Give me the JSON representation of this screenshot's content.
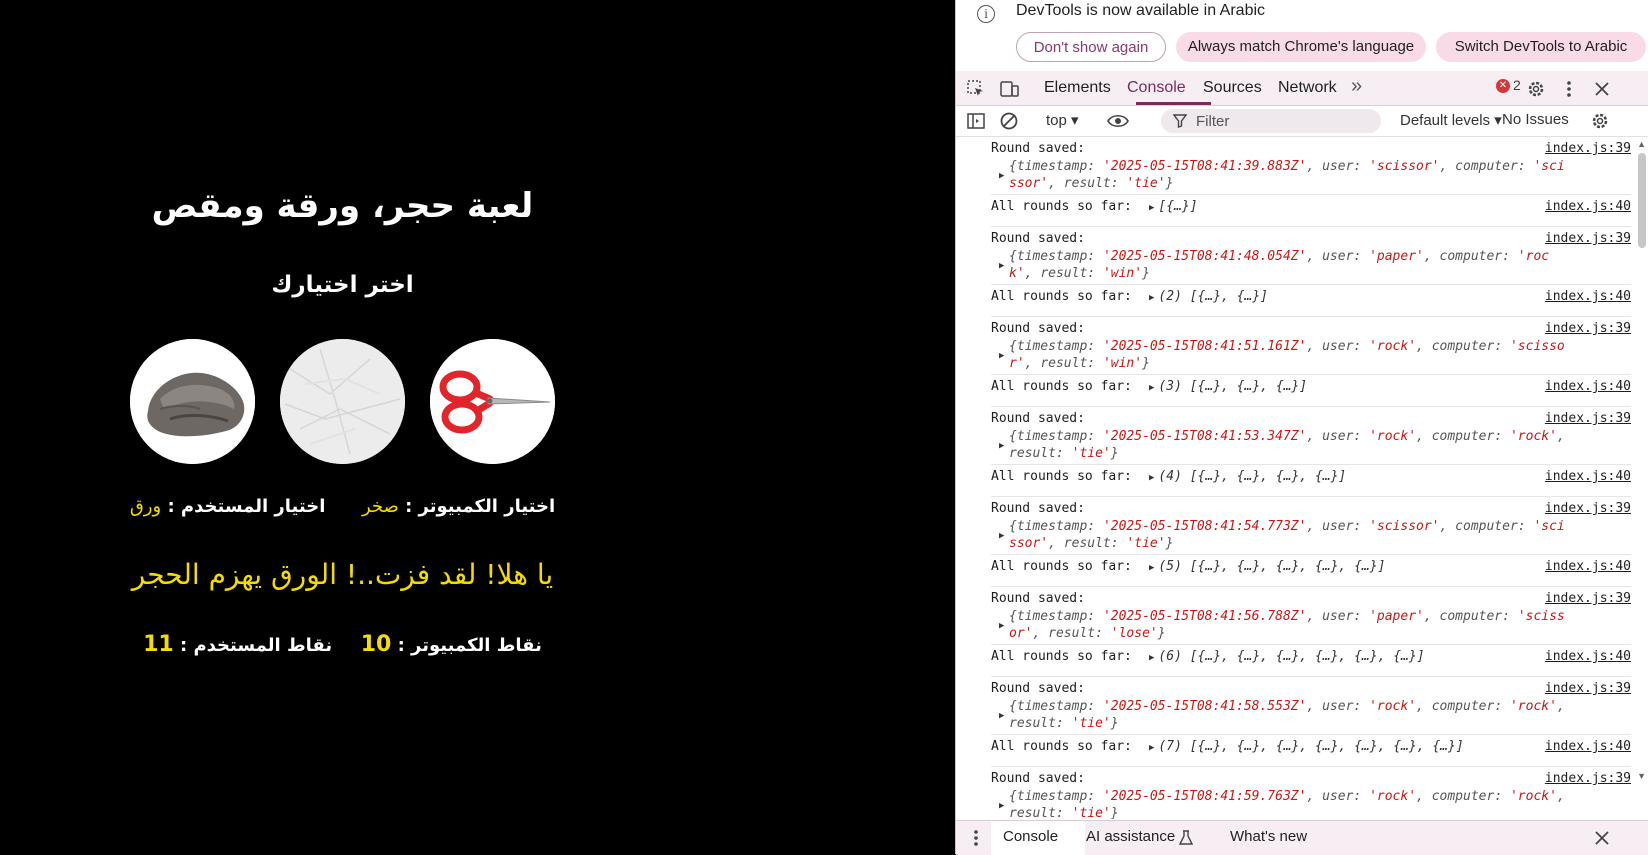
{
  "game": {
    "title": "لعبة حجر، ورقة ومقص",
    "subtitle": "اختر اختيارك",
    "choices": [
      {
        "name": "rock-choice",
        "label": "rock"
      },
      {
        "name": "paper-choice",
        "label": "paper"
      },
      {
        "name": "scissor-choice",
        "label": "scissor"
      }
    ],
    "computer_choice_label": "اختيار الكمبيوتر :",
    "computer_choice_value": "صخر",
    "user_choice_label": "اختيار المستخدم :",
    "user_choice_value": "ورق",
    "result_message": "يا هلا! لقد فزت..! الورق يهزم الحجر",
    "computer_score_label": "نقاط الكمبيوتر :",
    "computer_score": "10",
    "user_score_label": "نقاط المستخدم :",
    "user_score": "11",
    "accent_color": "#f4dc00"
  },
  "devtools": {
    "infobar": {
      "text": "DevTools is now available in Arabic",
      "dont_show": "Don't show again",
      "always_match": "Always match Chrome's language",
      "switch": "Switch DevTools to Arabic"
    },
    "tabs": {
      "elements": "Elements",
      "console": "Console",
      "sources": "Sources",
      "network": "Network",
      "more": "»",
      "error_count": "2"
    },
    "toolbar": {
      "context": "top ▾",
      "filter_placeholder": "Filter",
      "levels": "Default levels ▾",
      "issues": "No Issues"
    },
    "logs": [
      {
        "type": "saved",
        "msg": "Round saved:",
        "src": "index.js:39",
        "ts": "'2025-05-15T08:41:39.883Z'",
        "user": "'scissor'",
        "computer": "'scissor'",
        "result": "'tie'"
      },
      {
        "type": "all",
        "msg": "All rounds so far:",
        "src": "index.js:40",
        "arr": "[{…}]"
      },
      {
        "type": "saved",
        "msg": "Round saved:",
        "src": "index.js:39",
        "ts": "'2025-05-15T08:41:48.054Z'",
        "user": "'paper'",
        "computer": "'rock'",
        "result": "'win'"
      },
      {
        "type": "all",
        "msg": "All rounds so far:",
        "src": "index.js:40",
        "arr": "(2) [{…}, {…}]"
      },
      {
        "type": "saved",
        "msg": "Round saved:",
        "src": "index.js:39",
        "ts": "'2025-05-15T08:41:51.161Z'",
        "user": "'rock'",
        "computer": "'scissor'",
        "result": "'win'"
      },
      {
        "type": "all",
        "msg": "All rounds so far:",
        "src": "index.js:40",
        "arr": "(3) [{…}, {…}, {…}]"
      },
      {
        "type": "saved",
        "msg": "Round saved:",
        "src": "index.js:39",
        "ts": "'2025-05-15T08:41:53.347Z'",
        "user": "'rock'",
        "computer": "'rock'",
        "result": "'tie'"
      },
      {
        "type": "all",
        "msg": "All rounds so far:",
        "src": "index.js:40",
        "arr": "(4) [{…}, {…}, {…}, {…}]"
      },
      {
        "type": "saved",
        "msg": "Round saved:",
        "src": "index.js:39",
        "ts": "'2025-05-15T08:41:54.773Z'",
        "user": "'scissor'",
        "computer": "'scissor'",
        "result": "'tie'"
      },
      {
        "type": "all",
        "msg": "All rounds so far:",
        "src": "index.js:40",
        "arr": "(5) [{…}, {…}, {…}, {…}, {…}]"
      },
      {
        "type": "saved",
        "msg": "Round saved:",
        "src": "index.js:39",
        "ts": "'2025-05-15T08:41:56.788Z'",
        "user": "'paper'",
        "computer": "'scissor'",
        "result": "'lose'"
      },
      {
        "type": "all",
        "msg": "All rounds so far:",
        "src": "index.js:40",
        "arr": "(6) [{…}, {…}, {…}, {…}, {…}, {…}]"
      },
      {
        "type": "saved",
        "msg": "Round saved:",
        "src": "index.js:39",
        "ts": "'2025-05-15T08:41:58.553Z'",
        "user": "'rock'",
        "computer": "'rock'",
        "result": "'tie'"
      },
      {
        "type": "all",
        "msg": "All rounds so far:",
        "src": "index.js:40",
        "arr": "(7) [{…}, {…}, {…}, {…}, {…}, {…}, {…}]"
      },
      {
        "type": "saved",
        "msg": "Round saved:",
        "src": "index.js:39",
        "ts": "'2025-05-15T08:41:59.763Z'",
        "user": "'rock'",
        "computer": "'rock'",
        "result": "'tie'"
      }
    ],
    "drawer": {
      "console": "Console",
      "ai": "AI assistance",
      "whats_new": "What's new"
    }
  }
}
